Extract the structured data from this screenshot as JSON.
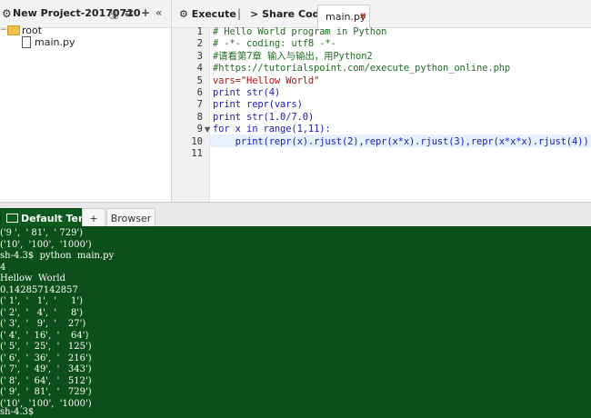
{
  "project": {
    "title": "New Project-20170710",
    "tree": {
      "root_label": "root",
      "file_label": "main.py"
    }
  },
  "toolbar": {
    "execute_label": "Execute",
    "separator": "|",
    "share_label": "Share Code",
    "tab_label": "main.py",
    "tab_close": "x"
  },
  "editor": {
    "line_numbers": [
      "1",
      "2",
      "3",
      "4",
      "5",
      "6",
      "7",
      "8",
      "9",
      "10",
      "11"
    ],
    "lines": [
      "# Hello World program in Python",
      "# -*- coding: utf8 -*-",
      "#请看第7章 输入与输出，用Python2",
      "#https://tutorialspoint.com/execute_python_online.php",
      "vars=\"Hellow World\"",
      "print str(4)",
      "print repr(vars)",
      "print str(1.0/7.0)",
      "for x in range(1,11):",
      "    print(repr(x).rjust(2),repr(x*x).rjust(3),repr(x*x*x).rjust(4))",
      ""
    ]
  },
  "terminal_tabs": {
    "active_label": "Default Term",
    "plus_label": "+",
    "browser_label": "Browser"
  },
  "terminal": {
    "lines": [
      "('9 ',  ' 81',  ' 729')",
      "('10',  '100',  '1000')",
      "sh-4.3$  python  main.py",
      "4",
      "Hellow  World",
      "0.142857142857",
      "(' 1',  '   1',  '     1')",
      "(' 2',  '   4',  '     8')",
      "(' 3',  '   9',  '    27')",
      "(' 4',  '  16',  '    64')",
      "(' 5',  '  25',  '   125')",
      "(' 6',  '  36',  '   216')",
      "(' 7',  '  49',  '   343')",
      "(' 8',  '  64',  '   512')",
      "(' 9',  '  81',  '   729')",
      "('10',  '100',  '1000')",
      "sh-4.3$"
    ]
  },
  "colors": {
    "terminal_bg": "#0d4f1a",
    "active_tab": "#0e5a1e",
    "comment": "#236e25",
    "code": "#1b1bb5",
    "string": "#aa1111"
  }
}
